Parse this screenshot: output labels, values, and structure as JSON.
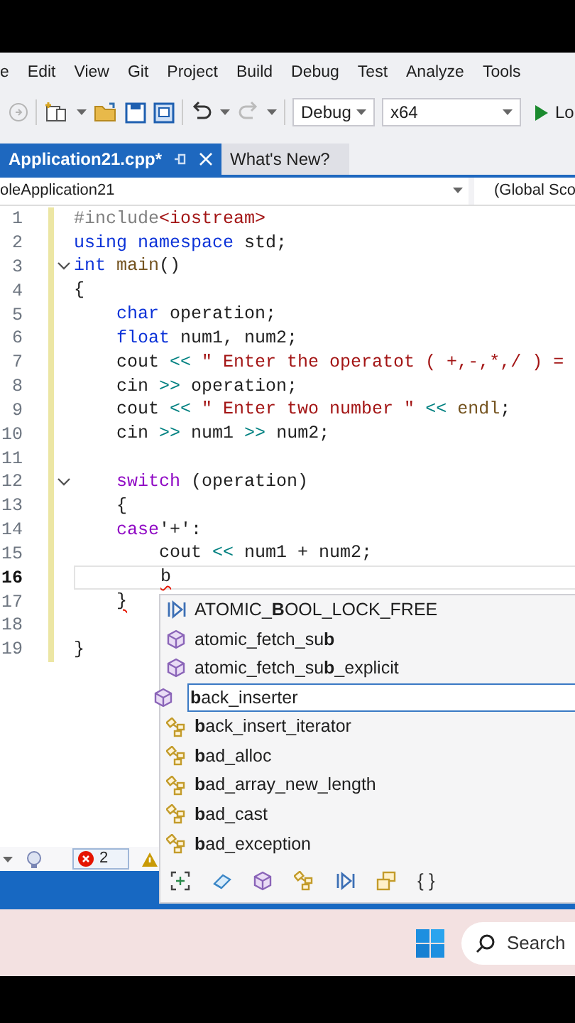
{
  "menu": [
    "e",
    "Edit",
    "View",
    "Git",
    "Project",
    "Build",
    "Debug",
    "Test",
    "Analyze",
    "Tools"
  ],
  "toolbar": {
    "configuration": "Debug",
    "platform": "x64",
    "run_label": "Lo"
  },
  "tabs": [
    {
      "label": "Application21.cpp*",
      "selected": true
    },
    {
      "label": "What's New?",
      "selected": false
    }
  ],
  "navigation": {
    "project": "oleApplication21",
    "scope": "(Global Sco"
  },
  "code_lines": [
    {
      "number": "1",
      "current": false,
      "fold": false,
      "tokens": [
        {
          "kind": "preproc",
          "text": "#include"
        },
        {
          "kind": "string",
          "text": "<iostream>"
        }
      ]
    },
    {
      "number": "2",
      "current": false,
      "fold": false,
      "tokens": [
        {
          "kind": "keyword",
          "text": "using namespace"
        },
        {
          "kind": "plain",
          "text": " std;"
        }
      ]
    },
    {
      "number": "3",
      "current": false,
      "fold": true,
      "tokens": [
        {
          "kind": "keyword",
          "text": "int"
        },
        {
          "kind": "function",
          "text": " main"
        },
        {
          "kind": "plain",
          "text": "()"
        }
      ]
    },
    {
      "number": "4",
      "current": false,
      "fold": false,
      "tokens": [
        {
          "kind": "plain",
          "text": "{"
        }
      ]
    },
    {
      "number": "5",
      "current": false,
      "fold": false,
      "tokens": [
        {
          "kind": "keyword",
          "text": "    char"
        },
        {
          "kind": "plain",
          "text": " operation;"
        }
      ]
    },
    {
      "number": "6",
      "current": false,
      "fold": false,
      "tokens": [
        {
          "kind": "keyword",
          "text": "    float"
        },
        {
          "kind": "plain",
          "text": " num1, num2;"
        }
      ]
    },
    {
      "number": "7",
      "current": false,
      "fold": false,
      "tokens": [
        {
          "kind": "plain",
          "text": "    cout "
        },
        {
          "kind": "operator",
          "text": "<<"
        },
        {
          "kind": "string",
          "text": " \" Enter the operatot ( +,-,*,/ ) ="
        }
      ]
    },
    {
      "number": "8",
      "current": false,
      "fold": false,
      "tokens": [
        {
          "kind": "plain",
          "text": "    cin "
        },
        {
          "kind": "operator",
          "text": ">>"
        },
        {
          "kind": "plain",
          "text": " operation;"
        }
      ]
    },
    {
      "number": "9",
      "current": false,
      "fold": false,
      "tokens": [
        {
          "kind": "plain",
          "text": "    cout "
        },
        {
          "kind": "operator",
          "text": "<<"
        },
        {
          "kind": "string",
          "text": " \" Enter two number \""
        },
        {
          "kind": "operator",
          "text": " <<"
        },
        {
          "kind": "function",
          "text": " endl"
        },
        {
          "kind": "plain",
          "text": ";"
        }
      ]
    },
    {
      "number": "10",
      "current": false,
      "fold": false,
      "tokens": [
        {
          "kind": "plain",
          "text": "    cin "
        },
        {
          "kind": "operator",
          "text": ">>"
        },
        {
          "kind": "plain",
          "text": " num1 "
        },
        {
          "kind": "operator",
          "text": ">>"
        },
        {
          "kind": "plain",
          "text": " num2;"
        }
      ]
    },
    {
      "number": "11",
      "current": false,
      "fold": false
    },
    {
      "number": "12",
      "current": false,
      "fold": true,
      "tokens": [
        {
          "kind": "control",
          "text": "    switch"
        },
        {
          "kind": "plain",
          "text": " (operation)"
        }
      ]
    },
    {
      "number": "13",
      "current": false,
      "fold": false,
      "tokens": [
        {
          "kind": "plain",
          "text": "    {"
        }
      ]
    },
    {
      "number": "14",
      "current": false,
      "fold": false,
      "tokens": [
        {
          "kind": "control",
          "text": "    case"
        },
        {
          "kind": "plain",
          "text": "'+':"
        }
      ]
    },
    {
      "number": "15",
      "current": false,
      "fold": false,
      "tokens": [
        {
          "kind": "plain",
          "text": "        cout "
        },
        {
          "kind": "operator",
          "text": "<<"
        },
        {
          "kind": "plain",
          "text": " num1 + num2;"
        }
      ]
    },
    {
      "number": "16",
      "current": true,
      "fold": false,
      "tokens": [
        {
          "kind": "error",
          "text": "        b"
        }
      ]
    },
    {
      "number": "17",
      "current": false,
      "fold": false,
      "tokens": [
        {
          "kind": "error",
          "text": "    }"
        }
      ]
    },
    {
      "number": "18",
      "current": false,
      "fold": false
    },
    {
      "number": "19",
      "current": false,
      "fold": false,
      "tokens": [
        {
          "kind": "plain",
          "text": "}"
        }
      ]
    }
  ],
  "completions": [
    {
      "kind": "macro",
      "label": "ATOMIC_**B**OOL_LOCK_FREE",
      "selected": false
    },
    {
      "kind": "function",
      "label": "atomic_fetch_su**b**",
      "selected": false
    },
    {
      "kind": "function",
      "label": "atomic_fetch_su**b**_explicit",
      "selected": false
    },
    {
      "kind": "function",
      "label": "**b**ack_inserter",
      "selected": true
    },
    {
      "kind": "class",
      "label": "**b**ack_insert_iterator",
      "selected": false
    },
    {
      "kind": "class",
      "label": "**b**ad_alloc",
      "selected": false
    },
    {
      "kind": "class",
      "label": "**b**ad_array_new_length",
      "selected": false
    },
    {
      "kind": "class",
      "label": "**b**ad_cast",
      "selected": false
    },
    {
      "kind": "class",
      "label": "**b**ad_exception",
      "selected": false
    }
  ],
  "completion_filters": [
    {
      "kind": "expand"
    },
    {
      "kind": "variable"
    },
    {
      "kind": "function"
    },
    {
      "kind": "class"
    },
    {
      "kind": "macro"
    },
    {
      "kind": "template"
    },
    {
      "kind": "namespace",
      "label": "{ }"
    }
  ],
  "status": {
    "errors": "2"
  },
  "taskbar": {
    "search_label": "Search"
  }
}
